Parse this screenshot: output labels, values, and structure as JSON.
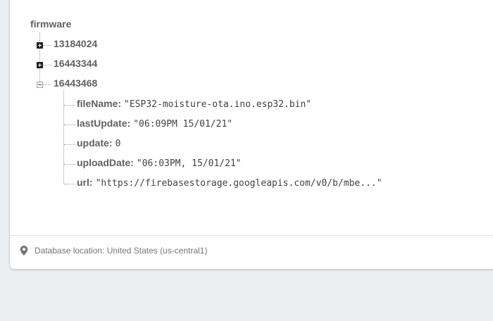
{
  "tree": {
    "root_label": "firmware",
    "collapsed_nodes": [
      {
        "key": "13184024"
      },
      {
        "key": "16443344"
      }
    ],
    "expanded_node": {
      "key": "16443468",
      "fields": [
        {
          "key": "fileName:",
          "value": "\"ESP32-moisture-ota.ino.esp32.bin\""
        },
        {
          "key": "lastUpdate:",
          "value": "\"06:09PM 15/01/21\""
        },
        {
          "key": "update:",
          "value": "0"
        },
        {
          "key": "uploadDate:",
          "value": "\"06:03PM, 15/01/21\""
        },
        {
          "key": "url:",
          "value": "\"https://firebasestorage.googleapis.com/v0/b/mbe...\""
        }
      ]
    }
  },
  "footer": {
    "icon": "location-pin-icon",
    "text": "Database location: United States (us-central1)"
  },
  "colors": {
    "background": "#eceff1",
    "card": "#ffffff",
    "key_text": "#616161",
    "value_text": "#424242"
  }
}
